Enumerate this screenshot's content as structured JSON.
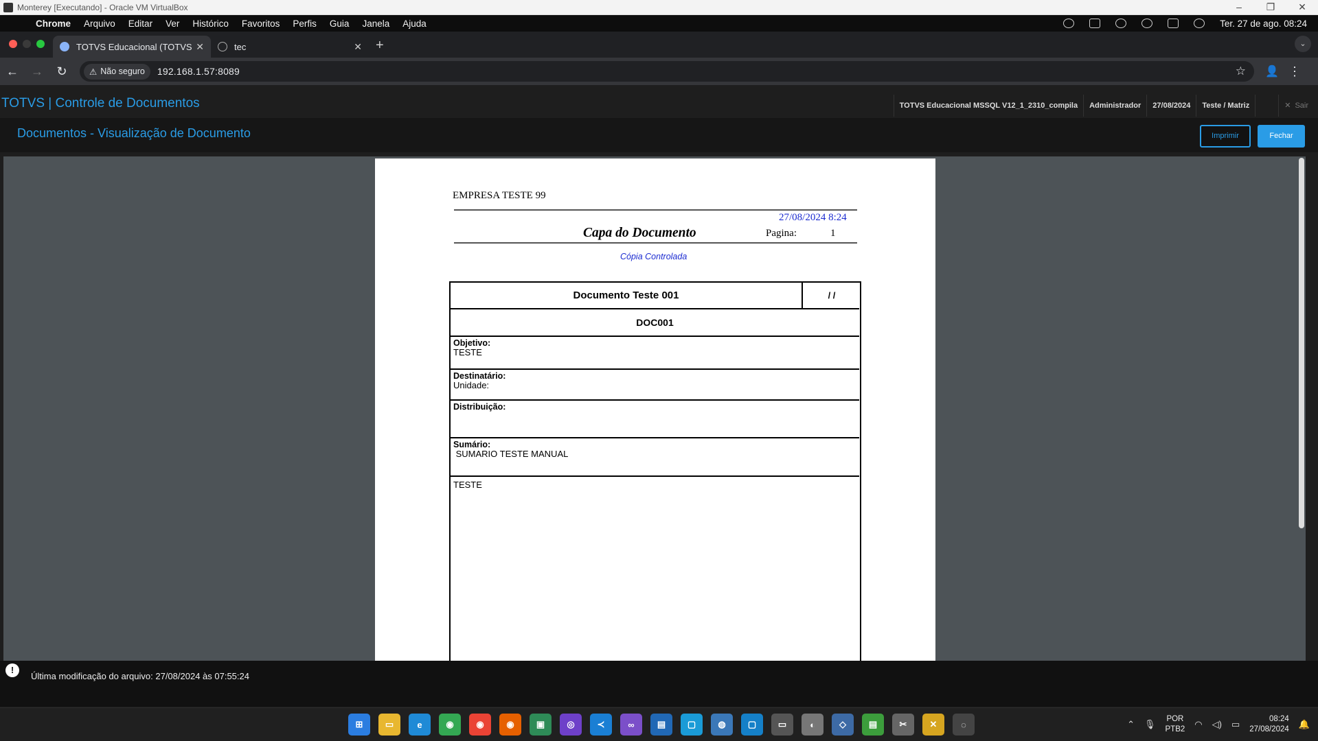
{
  "vbox": {
    "title": "Monterey [Executando] - Oracle VM VirtualBox",
    "controls": [
      "–",
      "❐",
      "✕"
    ]
  },
  "mac_menubar": {
    "apple_glyph": "",
    "items": [
      "Chrome",
      "Arquivo",
      "Editar",
      "Ver",
      "Histórico",
      "Favoritos",
      "Perfis",
      "Guia",
      "Janela",
      "Ajuda"
    ],
    "clock": "Ter. 27 de ago.  08:24"
  },
  "browser": {
    "tabs": [
      {
        "title": "TOTVS Educacional (TOTVS)",
        "close": "✕"
      },
      {
        "title": "tec",
        "close": "✕"
      }
    ],
    "new_tab": "+",
    "tab_menu": "⌄",
    "nav": {
      "back": "←",
      "forward": "→",
      "reload": "↻"
    },
    "security_label": "Não seguro",
    "security_glyph": "⚠",
    "url": "192.168.1.57:8089",
    "bookmark_glyph": "☆",
    "profile_glyph": "👤",
    "menu_glyph": "⋮"
  },
  "app": {
    "title": "TOTVS | Controle de Documentos",
    "context": "TOTVS Educacional MSSQL V12_1_2310_compila",
    "user": "Administrador",
    "date": "27/08/2024",
    "branch": "Teste / Matriz",
    "logout_glyph": "✕",
    "logout": "Sair",
    "subtitle": "Documentos - Visualização de Documento",
    "print_button": "Imprimir",
    "close_button": "Fechar"
  },
  "document": {
    "company": "EMPRESA TESTE 99",
    "print_date": "27/08/2024    8:24",
    "heading": "Capa do Documento",
    "page_label": "Pagina:",
    "page_number": "1",
    "controlled_copy": "Cópia Controlada",
    "title": "Documento Teste 001",
    "revision_date": "/  /",
    "code": "DOC001",
    "objective_label": "Objetivo:",
    "objective_value": "TESTE",
    "recipient_label": "Destinatário:",
    "recipient_value": "Unidade:",
    "distribution_label": "Distribuição:",
    "summary_label": "Sumário:",
    "summary_value": " SUMARIO TESTE MANUAL",
    "body_text": "TESTE"
  },
  "status": {
    "info_glyph": "!",
    "message": "Última modificação do arquivo: 27/08/2024 às 07:55:24"
  },
  "taskbar": {
    "apps": [
      {
        "name": "windows-start",
        "color": "#2b7de0",
        "glyph": "⊞"
      },
      {
        "name": "file-explorer",
        "color": "#e8b730",
        "glyph": "▭"
      },
      {
        "name": "edge",
        "color": "#1f8ad6",
        "glyph": "e"
      },
      {
        "name": "chrome-1",
        "color": "#34a853",
        "glyph": "◉"
      },
      {
        "name": "chrome-2",
        "color": "#ea4335",
        "glyph": "◉"
      },
      {
        "name": "firefox",
        "color": "#e66000",
        "glyph": "◉"
      },
      {
        "name": "teams",
        "color": "#2e8b57",
        "glyph": "▣"
      },
      {
        "name": "github",
        "color": "#6e40c9",
        "glyph": "◎"
      },
      {
        "name": "vscode",
        "color": "#1a7fd4",
        "glyph": "≺"
      },
      {
        "name": "visual-studio",
        "color": "#7b4fc9",
        "glyph": "∞"
      },
      {
        "name": "app-blue-1",
        "color": "#2168b5",
        "glyph": "▤"
      },
      {
        "name": "app-blue-2",
        "color": "#1a9bd7",
        "glyph": "▢"
      },
      {
        "name": "app-globe",
        "color": "#3b78b8",
        "glyph": "◍"
      },
      {
        "name": "app-blue-3",
        "color": "#1580c8",
        "glyph": "▢"
      },
      {
        "name": "app-monitor",
        "color": "#555555",
        "glyph": "▭"
      },
      {
        "name": "app-circle",
        "color": "#777777",
        "glyph": "◐"
      },
      {
        "name": "virtualbox",
        "color": "#3d6aa5",
        "glyph": "◇"
      },
      {
        "name": "notepad-green",
        "color": "#3c9d3c",
        "glyph": "▤"
      },
      {
        "name": "snipping",
        "color": "#666666",
        "glyph": "✂"
      },
      {
        "name": "app-tools",
        "color": "#d6a520",
        "glyph": "✕"
      },
      {
        "name": "app-ring",
        "color": "#444444",
        "glyph": "◌"
      }
    ],
    "tray_up": "⌃",
    "mic": "🎙",
    "lang_line1": "POR",
    "lang_line2": "PTB2",
    "wifi": "◠",
    "volume": "◁)",
    "battery": "▭",
    "time": "08:24",
    "date": "27/08/2024",
    "bell": "🔔"
  }
}
